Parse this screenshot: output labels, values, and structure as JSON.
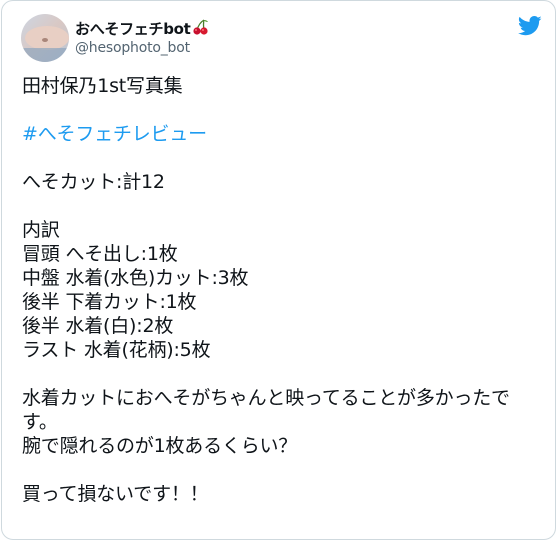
{
  "tweet": {
    "display_name": "おへそフェチbot",
    "handle": "@hesophoto_bot",
    "lines": {
      "title": "田村保乃1st写真集",
      "hashtag": "#へそフェチレビュー",
      "total": "へそカット:計12",
      "breakdown_header": "内訳",
      "item1": "冒頭 へそ出し:1枚",
      "item2": "中盤 水着(水色)カット:3枚",
      "item3": "後半 下着カット:1枚",
      "item4": "後半 水着(白):2枚",
      "item5": "ラスト 水着(花柄):5枚",
      "comment1": "水着カットにおへそがちゃんと映ってることが多かったです。",
      "comment2": "腕で隠れるのが1枚あるくらい？",
      "closing": "買って損ないです！！"
    }
  },
  "colors": {
    "brand": "#1d9bf0",
    "text": "#0f1419",
    "secondary": "#536471",
    "border": "#cfd9de"
  },
  "icons": {
    "avatar": "avatar-image",
    "emoji": "cherry-icon",
    "brand": "twitter-bird-icon"
  }
}
